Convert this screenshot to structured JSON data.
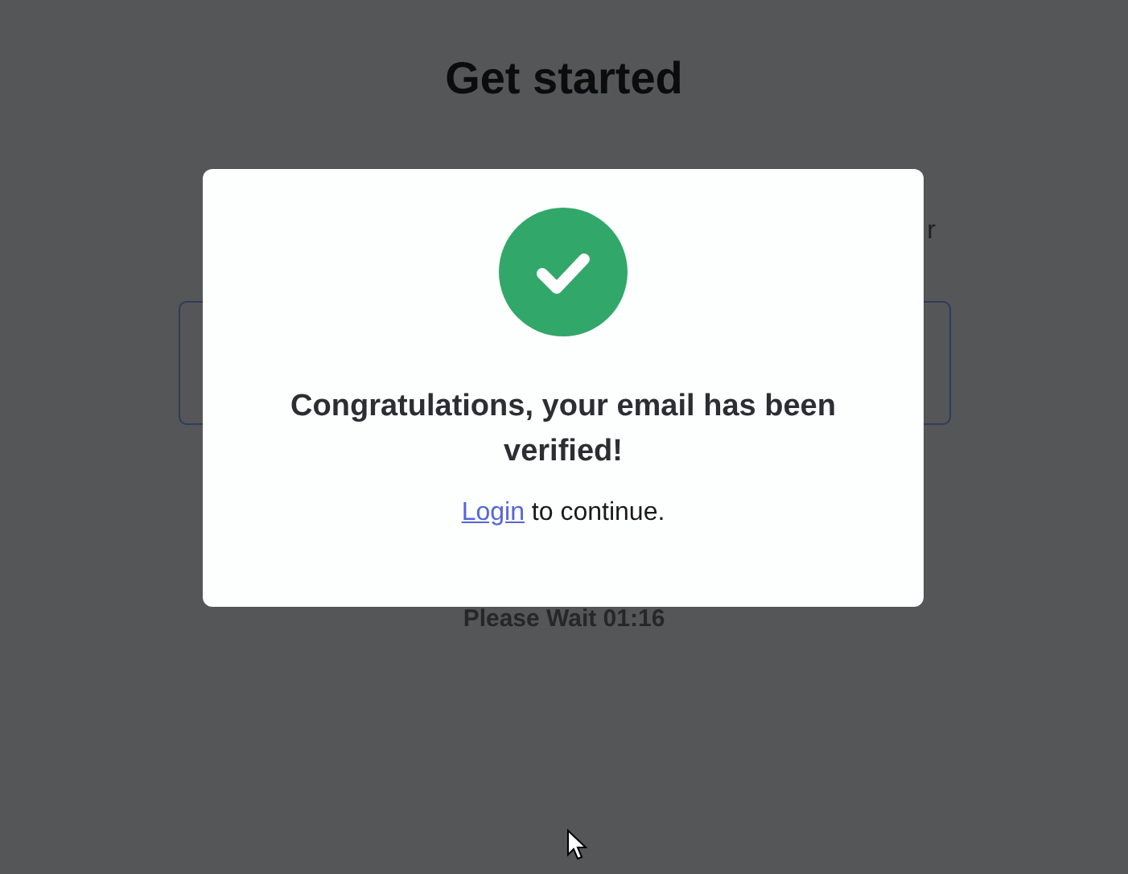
{
  "page": {
    "title": "Get started",
    "subtitle_fragment": "r",
    "timer": "Please Wait 01:16"
  },
  "dialog": {
    "message": "Congratulations, your email has been verified!",
    "link": "Login",
    "link_suffix": " to continue."
  }
}
